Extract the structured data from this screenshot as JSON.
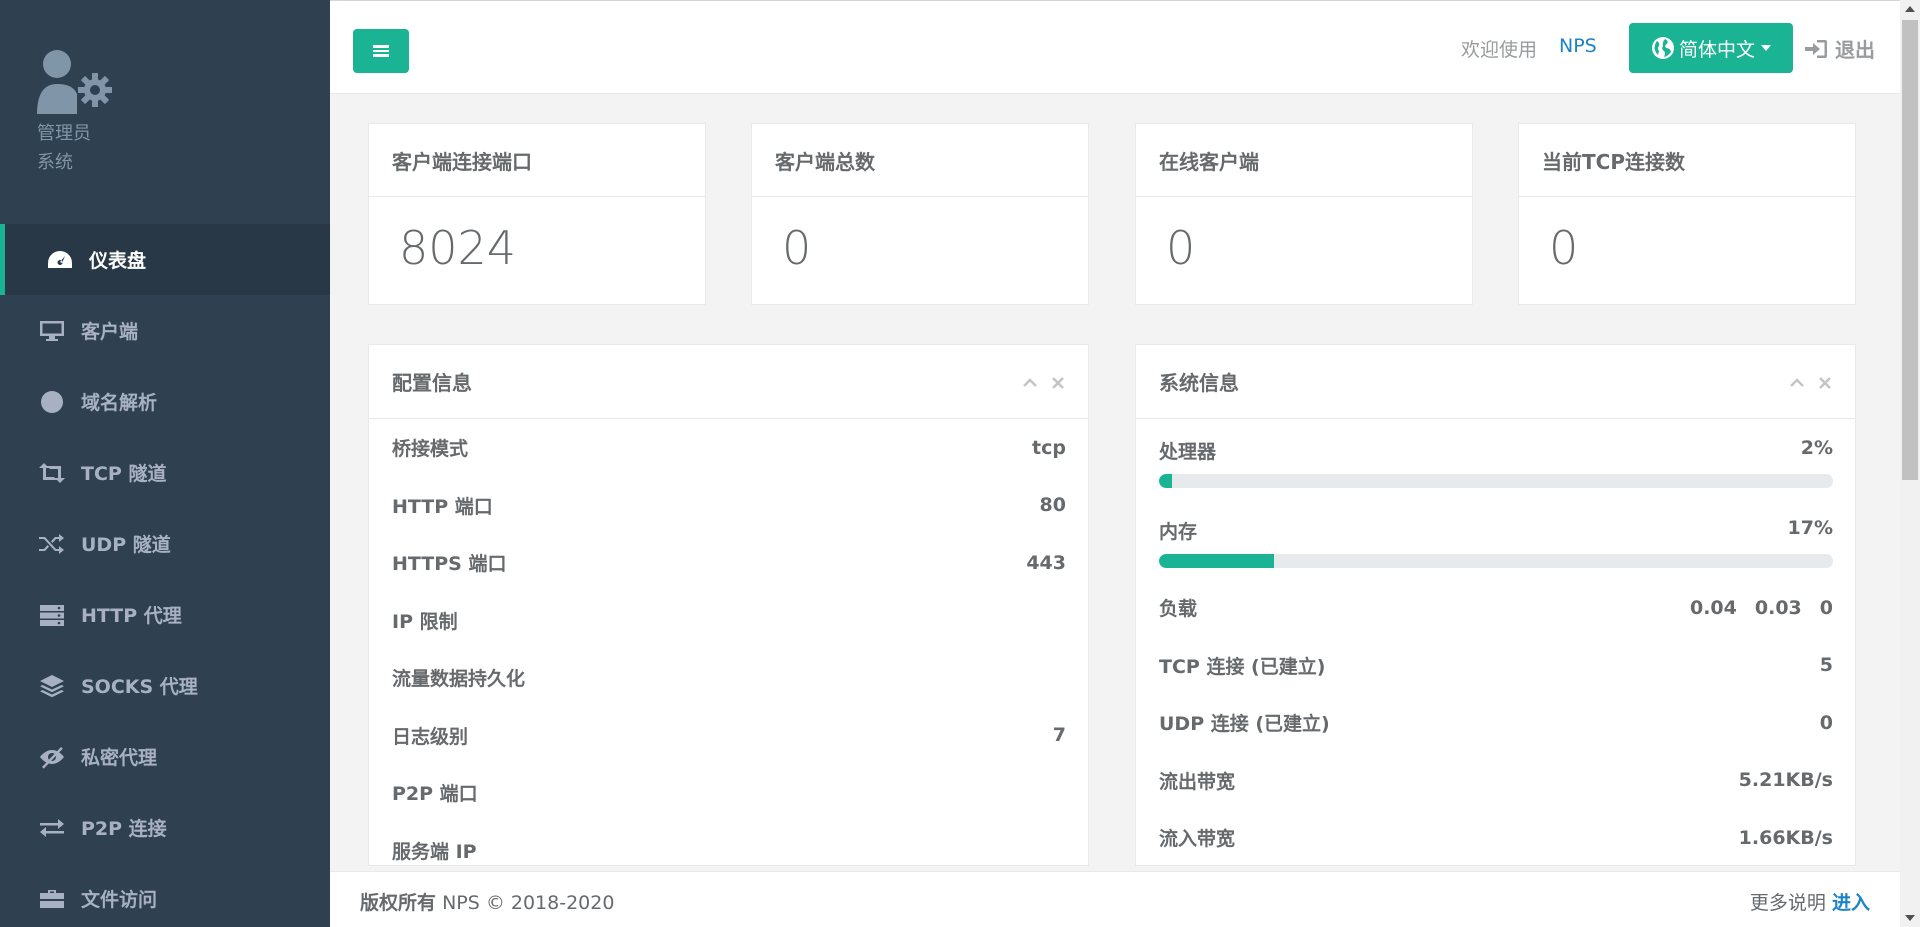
{
  "sidebar": {
    "profile_name": "管理员",
    "profile_role": "系统",
    "items": [
      {
        "label": "仪表盘",
        "icon": "dashboard-icon",
        "active": true
      },
      {
        "label": "客户端",
        "icon": "desktop-icon"
      },
      {
        "label": "域名解析",
        "icon": "globe-icon"
      },
      {
        "label": "TCP 隧道",
        "icon": "retweet-icon"
      },
      {
        "label": "UDP 隧道",
        "icon": "random-icon"
      },
      {
        "label": "HTTP 代理",
        "icon": "server-icon"
      },
      {
        "label": "SOCKS 代理",
        "icon": "layers-icon"
      },
      {
        "label": "私密代理",
        "icon": "eye-slash-icon"
      },
      {
        "label": "P2P 连接",
        "icon": "exchange-icon"
      },
      {
        "label": "文件访问",
        "icon": "briefcase-icon"
      }
    ]
  },
  "topbar": {
    "welcome": "欢迎使用",
    "brand_link": "NPS",
    "language": "简体中文",
    "logout": "退出"
  },
  "stats": [
    {
      "label": "客户端连接端口",
      "value": "8024"
    },
    {
      "label": "客户端总数",
      "value": "0"
    },
    {
      "label": "在线客户端",
      "value": "0"
    },
    {
      "label": "当前TCP连接数",
      "value": "0"
    }
  ],
  "config_panel": {
    "title": "配置信息",
    "rows": [
      {
        "label": "桥接模式",
        "value": "tcp"
      },
      {
        "label": "HTTP 端口",
        "value": "80"
      },
      {
        "label": "HTTPS 端口",
        "value": "443"
      },
      {
        "label": "IP 限制",
        "value": ""
      },
      {
        "label": "流量数据持久化",
        "value": ""
      },
      {
        "label": "日志级别",
        "value": "7"
      },
      {
        "label": "P2P 端口",
        "value": ""
      },
      {
        "label": "服务端 IP",
        "value": ""
      }
    ]
  },
  "system_panel": {
    "title": "系统信息",
    "cpu": {
      "label": "处理器",
      "value": "2%",
      "percent": 2
    },
    "memory": {
      "label": "内存",
      "value": "17%",
      "percent": 17
    },
    "load": {
      "label": "负载",
      "values": [
        "0.04",
        "0.03",
        "0"
      ]
    },
    "rows": [
      {
        "label": "TCP 连接 (已建立)",
        "value": "5"
      },
      {
        "label": "UDP 连接 (已建立)",
        "value": "0"
      },
      {
        "label": "流出带宽",
        "value": "5.21KB/s"
      },
      {
        "label": "流入带宽",
        "value": "1.66KB/s"
      }
    ]
  },
  "footer": {
    "copyright_bold": "版权所有",
    "copyright_text": "NPS © 2018-2020",
    "more_text": "更多说明",
    "more_link": "进入"
  },
  "colors": {
    "accent": "#1ab394",
    "sidebar_bg": "#2f4050",
    "link": "#1c84c6"
  }
}
